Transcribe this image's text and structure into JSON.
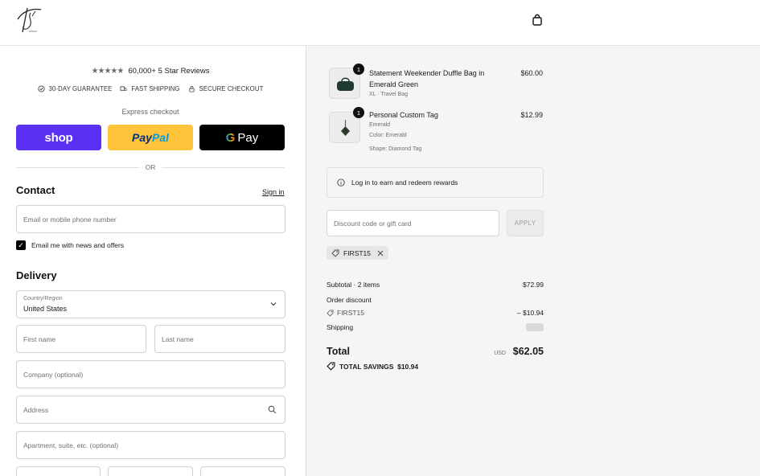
{
  "header": {
    "logo_label": "logo",
    "cart_icon": "shopping-bag-icon"
  },
  "trust": {
    "stars": "★★★★★",
    "reviews": "60,000+ 5 Star Reviews",
    "guarantees": [
      "30-DAY GUARANTEE",
      "FAST SHIPPING",
      "SECURE CHECKOUT"
    ]
  },
  "express": {
    "label": "Express checkout",
    "shop": "shop",
    "paypal_a": "Pay",
    "paypal_b": "Pal",
    "gpay_g": "G",
    "gpay_text": "Pay",
    "or": "OR"
  },
  "contact": {
    "title": "Contact",
    "signin": "Sign in",
    "email_placeholder": "Email or mobile phone number",
    "newsletter": "Email me with news and offers",
    "newsletter_checked": true
  },
  "delivery": {
    "title": "Delivery",
    "country_label": "Country/Region",
    "country_value": "United States",
    "first_name": "First name",
    "last_name": "Last name",
    "company": "Company (optional)",
    "address": "Address",
    "apartment": "Apartment, suite, etc. (optional)"
  },
  "cart": {
    "items": [
      {
        "qty": "1",
        "name": "Statement Weekender Duffle Bag in Emerald Green",
        "details": [
          "XL · Travel Bag"
        ],
        "price": "$60.00"
      },
      {
        "qty": "1",
        "name": "Personal Custom Tag",
        "details": [
          "Emerald",
          "Color: Emerald",
          "Shape: Diamond Tag"
        ],
        "price": "$12.99"
      }
    ],
    "rewards": "Log in to earn and redeem rewards",
    "discount_placeholder": "Discount code or gift card",
    "apply": "APPLY",
    "applied_code": "FIRST15",
    "subtotal_label": "Subtotal · 2 items",
    "subtotal_value": "$72.99",
    "order_discount_label": "Order discount",
    "discount_code": "FIRST15",
    "discount_value": "– $10.94",
    "shipping_label": "Shipping",
    "total_label": "Total",
    "currency": "USD",
    "total_value": "$62.05",
    "savings": "TOTAL SAVINGS  $10.94"
  },
  "colors": {
    "shop": "#5a31f4",
    "paypal": "#ffc439",
    "gpay": "#000000",
    "right_bg": "#f5f5f5"
  }
}
